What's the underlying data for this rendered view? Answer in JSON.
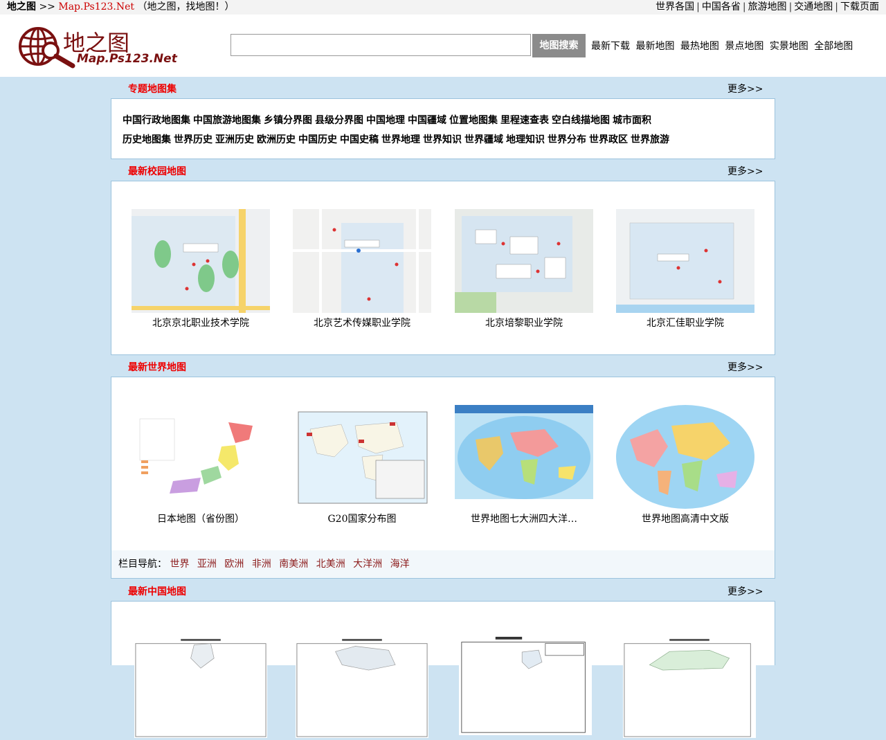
{
  "topbar": {
    "brand": "地之图",
    "arrows": ">>",
    "site": "Map.Ps123.Net",
    "slogan": "（地之图，找地图！）",
    "links": [
      "世界各国",
      "中国各省",
      "旅游地图",
      "交通地图",
      "下载页面"
    ]
  },
  "header": {
    "logo_cn": "地之图",
    "logo_en": "Map.Ps123.Net",
    "search_value": "",
    "search_button": "地图搜索",
    "links": [
      "最新下载",
      "最新地图",
      "最热地图",
      "景点地图",
      "实景地图",
      "全部地图"
    ]
  },
  "sections": {
    "topic": {
      "title": "专题地图集",
      "more": "更多>>",
      "row1": [
        "中国行政地图集",
        "中国旅游地图集",
        "乡镇分界图",
        "县级分界图",
        "中国地理",
        "中国疆域",
        "位置地图集",
        "里程速查表",
        "空白线描地图",
        "城市面积"
      ],
      "row2": [
        "历史地图集",
        "世界历史",
        "亚洲历史",
        "欧洲历史",
        "中国历史",
        "中国史稿",
        "世界地理",
        "世界知识",
        "世界疆域",
        "地理知识",
        "世界分布",
        "世界政区",
        "世界旅游"
      ]
    },
    "campus": {
      "title": "最新校园地图",
      "more": "更多>>",
      "cards": [
        "北京京北职业技术学院",
        "北京艺术传媒职业学院",
        "北京培黎职业学院",
        "北京汇佳职业学院"
      ]
    },
    "world": {
      "title": "最新世界地图",
      "more": "更多>>",
      "cards": [
        "日本地图（省份图）",
        "G20国家分布图",
        "世界地图七大洲四大洋…",
        "世界地图高清中文版"
      ],
      "subnav_label": "栏目导航：",
      "subnav": [
        "世界",
        "亚洲",
        "欧洲",
        "非洲",
        "南美洲",
        "北美洲",
        "大洋洲",
        "海洋"
      ]
    },
    "china": {
      "title": "最新中国地图",
      "more": "更多>>"
    }
  },
  "colors": {
    "accent_red": "#e00000",
    "logo": "#7a1010",
    "page_bg": "#cde3f2",
    "nav_link": "#8b1a1a"
  }
}
